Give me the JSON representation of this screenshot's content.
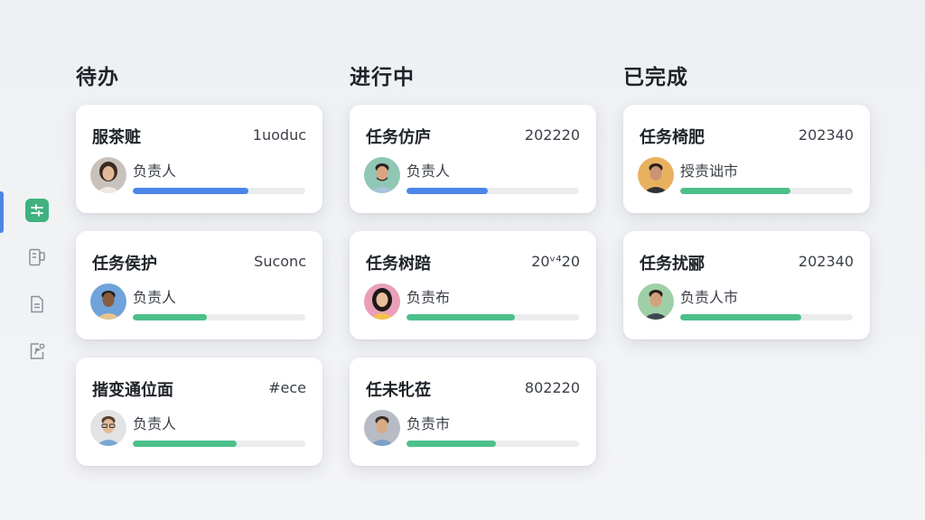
{
  "sidebar": {
    "items": [
      {
        "icon": "kanban-icon",
        "active": true
      },
      {
        "icon": "board-doc-icon",
        "active": false
      },
      {
        "icon": "document-icon",
        "active": false
      },
      {
        "icon": "ai-edit-icon",
        "active": false
      }
    ]
  },
  "colors": {
    "accent_blue": "#4a86e8",
    "accent_green": "#4cc08a",
    "active_icon_bg": "#3fb27f"
  },
  "columns": [
    {
      "title": "待办",
      "cards": [
        {
          "title": "服茶赃",
          "code": "1uoduc",
          "assignee": "负责人",
          "progress": 0.67,
          "color": "#4a86e8",
          "avatar": "woman-dark-hair"
        },
        {
          "title": "任务侯护",
          "code": "Suconc",
          "assignee": "负责人",
          "progress": 0.43,
          "color": "#4cc08a",
          "avatar": "man-dark-skin"
        },
        {
          "title": "揩变通位面",
          "code": "#ece",
          "assignee": "负责人",
          "progress": 0.6,
          "color": "#4cc08a",
          "avatar": "man-glasses"
        }
      ]
    },
    {
      "title": "进行中",
      "cards": [
        {
          "title": "任务仿庐",
          "code": "202220",
          "assignee": "负责人",
          "progress": 0.47,
          "color": "#4a86e8",
          "avatar": "man-bearded"
        },
        {
          "title": "任务树踣",
          "code": "20ᵛ⁴20",
          "assignee": "负责布",
          "progress": 0.63,
          "color": "#4cc08a",
          "avatar": "woman-long-hair"
        },
        {
          "title": "任未牝莅",
          "code": "802220",
          "assignee": "负责市",
          "progress": 0.52,
          "color": "#4cc08a",
          "avatar": "man-short-hair"
        }
      ]
    },
    {
      "title": "已完成",
      "cards": [
        {
          "title": "任务椅肥",
          "code": "202340",
          "assignee": "授责诎市",
          "progress": 0.64,
          "color": "#4cc08a",
          "avatar": "man-tan-background"
        },
        {
          "title": "任务扰郦",
          "code": "202340",
          "assignee": "负责人市",
          "progress": 0.7,
          "color": "#4cc08a",
          "avatar": "man-green-background"
        }
      ]
    }
  ]
}
